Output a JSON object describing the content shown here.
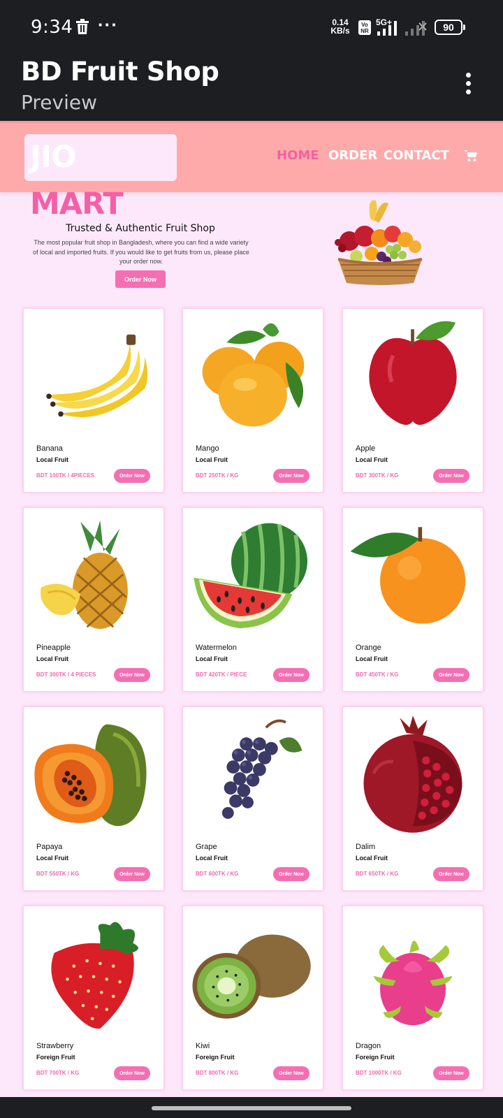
{
  "status_bar": {
    "time": "9:34",
    "speed_value": "0.14",
    "speed_unit": "KB/s",
    "volte": "Vo NR",
    "network": "5G+",
    "battery": "90",
    "icons": [
      "trash-icon",
      "more-dots-icon",
      "signal-icon",
      "signal-no-service-icon",
      "battery-icon"
    ]
  },
  "app_bar": {
    "title": "BD Fruit Shop",
    "subtitle": "Preview"
  },
  "site": {
    "logo_part1": "JIO",
    "logo_part2": "MART",
    "nav": [
      "HOME",
      "ORDER",
      "CONTACT"
    ],
    "active_nav": "HOME",
    "colors": {
      "header": "#ffaaaa",
      "page_bg": "#fde8fb",
      "accent": "#f46fb2",
      "price": "#f06aae"
    }
  },
  "hero": {
    "title": "Trusted & Authentic Fruit Shop",
    "text": "The most popular fruit shop in Bangladesh, where you can find a wide variety of local and imported fruits. If you would like to get fruits from us, please place your order now.",
    "button": "Order Now"
  },
  "products": [
    {
      "name": "Banana",
      "type": "Local Fruit",
      "price": "BDT 100TK / 4PIECES",
      "button": "Order Now"
    },
    {
      "name": "Mango",
      "type": "Local Fruit",
      "price": "BDT 250TK / KG",
      "button": "Order Now"
    },
    {
      "name": "Apple",
      "type": "Local Fruit",
      "price": "BDT 300TK / KG",
      "button": "Order Now"
    },
    {
      "name": "Pineapple",
      "type": "Local Fruit",
      "price": "BDT 300TK / 4 PIECES",
      "button": "Order Now"
    },
    {
      "name": "Watermelon",
      "type": "Local Fruit",
      "price": "BDT 420TK / PIECE",
      "button": "Order Now"
    },
    {
      "name": "Orange",
      "type": "Local Fruit",
      "price": "BDT 450TK / KG",
      "button": "Order Now"
    },
    {
      "name": "Papaya",
      "type": "Local Fruit",
      "price": "BDT 550TK / KG",
      "button": "Order Now"
    },
    {
      "name": "Grape",
      "type": "Local Fruit",
      "price": "BDT 600TK / KG",
      "button": "Order Now"
    },
    {
      "name": "Dalim",
      "type": "Local Fruit",
      "price": "BDT 650TK / KG",
      "button": "Order Now"
    },
    {
      "name": "Strawberry",
      "type": "Foreign Fruit",
      "price": "BDT 700TK / KG",
      "button": "Order Now"
    },
    {
      "name": "Kiwi",
      "type": "Foreign Fruit",
      "price": "BDT 800TK / KG",
      "button": "Order Now"
    },
    {
      "name": "Dragon",
      "type": "Foreign Fruit",
      "price": "BDT 1000TK / KG",
      "button": "Order Now"
    }
  ]
}
